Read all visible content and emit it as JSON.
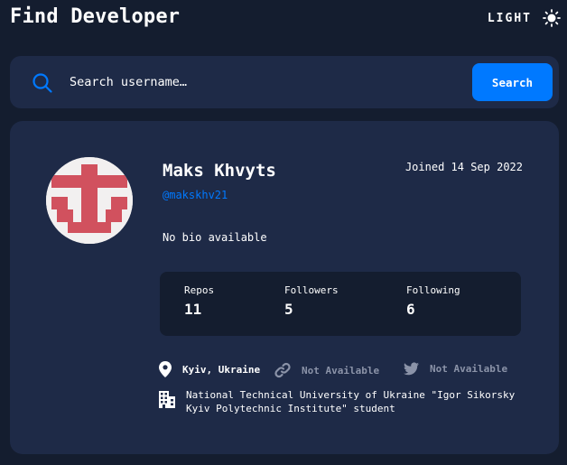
{
  "header": {
    "title": "Find Developer",
    "theme_toggle_label": "LIGHT",
    "theme_icon": "sun-icon"
  },
  "search": {
    "placeholder": "Search username…",
    "value": "",
    "button_label": "Search",
    "icon": "search-icon"
  },
  "profile": {
    "name": "Maks Khvyts",
    "login": "@makskhv21",
    "joined": "Joined 14 Sep 2022",
    "bio": "No bio available",
    "avatar": "avatar-identicon"
  },
  "stats": [
    {
      "label": "Repos",
      "value": "11"
    },
    {
      "label": "Followers",
      "value": "5"
    },
    {
      "label": "Following",
      "value": "6"
    }
  ],
  "links": {
    "location": "Kyiv, Ukraine",
    "blog": "Not Available",
    "twitter": "Not Available",
    "company_line1": "National Technical University of Ukraine \"Igor Sikorsky",
    "company_line2": "Kyiv Polytechnic Institute\" student"
  },
  "colors": {
    "background": "#141d2f",
    "card": "#1e2a47",
    "accent": "#0079ff",
    "avatar_fill": "#d1515e",
    "muted": "#8b93a8"
  }
}
